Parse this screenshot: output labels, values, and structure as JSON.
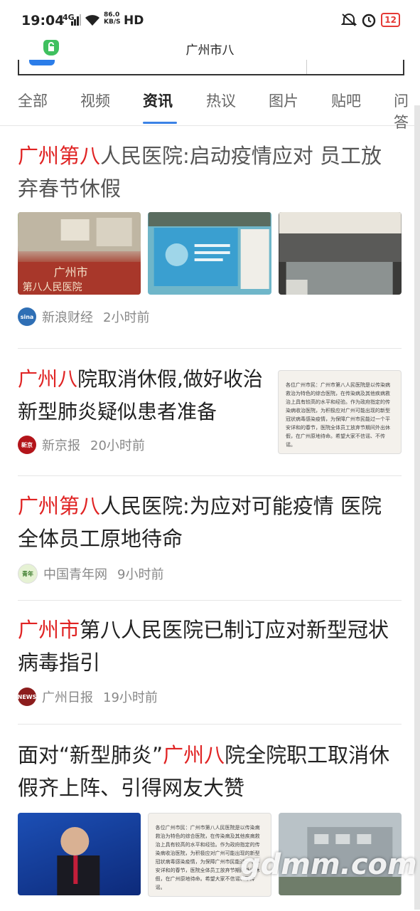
{
  "status": {
    "time": "19:04",
    "network": "4G",
    "speed_top": "86.0",
    "speed_bottom": "KB/S",
    "hd": "HD",
    "battery": "12"
  },
  "header": {
    "title": "广州市八"
  },
  "tabs": [
    "全部",
    "视频",
    "资讯",
    "热议",
    "图片",
    "贴吧",
    "问答"
  ],
  "active_tab": "资讯",
  "articles": [
    {
      "title_hl": "广州第八",
      "title_rest": "人民医院:启动疫情应对 员工放弃春节休假",
      "source": "新浪财经",
      "time": "2小时前",
      "images": [
        "广州市",
        "第八人民医院",
        ""
      ]
    },
    {
      "title_hl": "广州八",
      "title_rest": "院取消休假,做好收治新型肺炎疑似患者准备",
      "source": "新京报",
      "time": "20小时前",
      "thumb_text": "各位广州市民：广州市第八人民医院是以传染病救治为特色的综合医院，在传染病及其他疾病救治上具有较高的水平和经验。作为政府指定的传染病收治医院，为积极应对广州可能出现的新型冠状病毒感染疫情，为保障广州市民能过一个平安详和的春节，医院全体员工放弃节期间外出休假，在广州原地待命。希望大家不信谣、不传谣。"
    },
    {
      "title_hl": "广州第八",
      "title_rest": "人民医院:为应对可能疫情 医院全体员工原地待命",
      "source": "中国青年网",
      "time": "9小时前"
    },
    {
      "title_hl": "广州市",
      "title_rest": "第八人民医院已制订应对新型冠状病毒指引",
      "source": "广州日报",
      "time": "19小时前"
    },
    {
      "title_pre": "面对“新型肺炎”",
      "title_hl": "广州八",
      "title_rest": "院全院职工取消休假齐上阵、引得网友大赞",
      "watermark": "gdmm.com"
    }
  ]
}
